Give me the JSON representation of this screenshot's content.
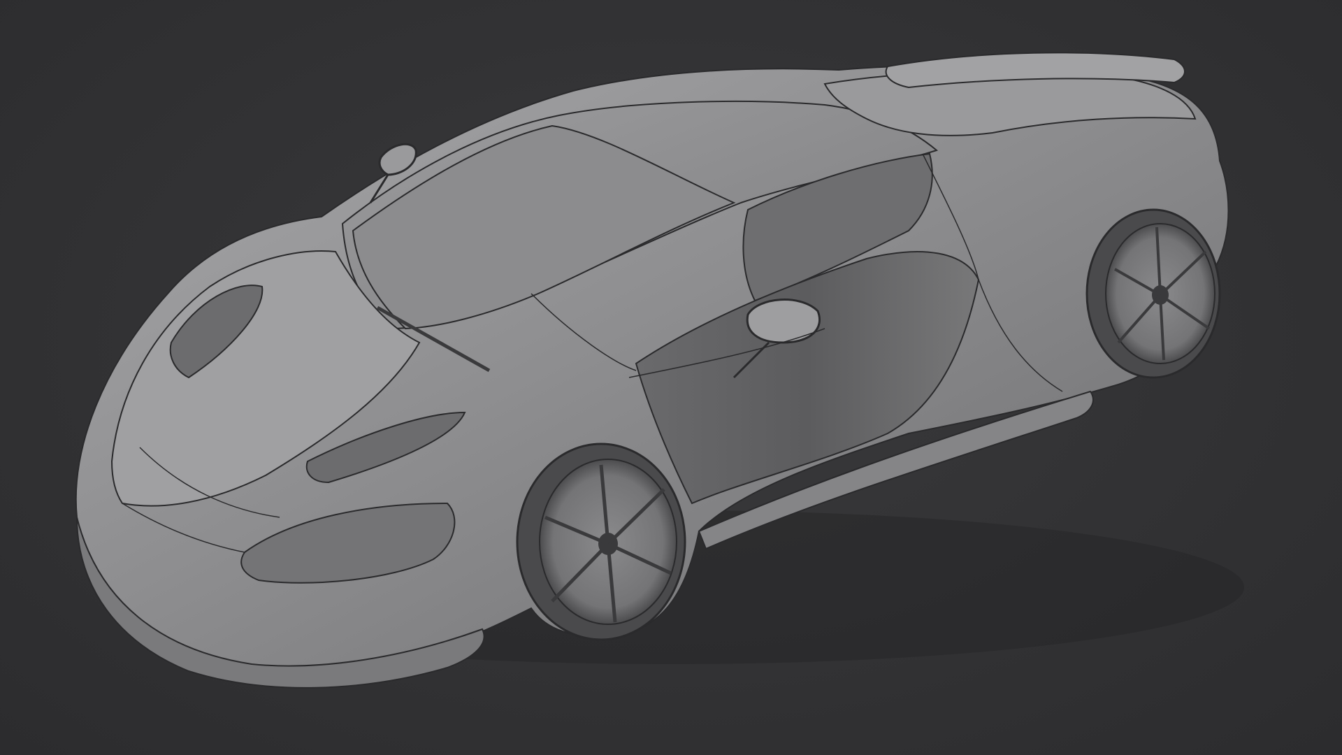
{
  "viewport": {
    "background_color": "#313133",
    "model_base_color": "#8a8a8c",
    "model_highlight_color": "#b4b4b6",
    "model_shadow_color": "#5a5a5c",
    "panel_line_color": "#2a2a2c"
  }
}
